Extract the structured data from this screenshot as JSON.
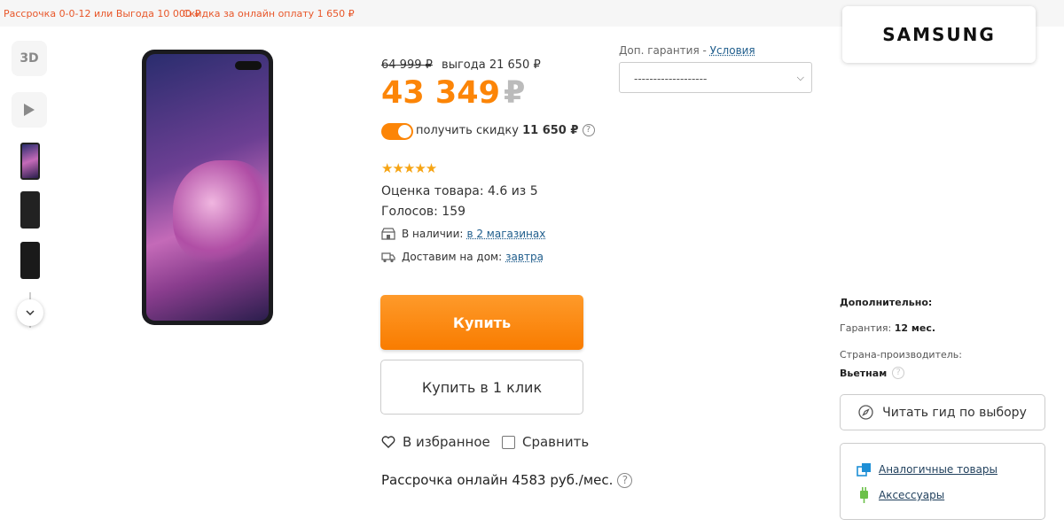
{
  "promo": {
    "installment": "Рассрочка 0-0-12 или Выгода 10 000 ₽",
    "online_discount": "Скидка за онлайн оплату 1 650 ₽"
  },
  "gallery": {
    "btn_3d": "3D",
    "colors": {
      "phone_body": "#1b1b1f"
    }
  },
  "price": {
    "old": "64 999 ₽",
    "benefit": "выгода 21 650 ₽",
    "current": "43 349",
    "currency": "₽",
    "discount_label": "получить скидку",
    "discount_value": "11 650 ₽",
    "accent_color": "#fc8507"
  },
  "rating": {
    "value": 4.6,
    "max": 5,
    "stars": "★★★★★",
    "score_text": "Оценка товара: 4.6 из 5",
    "votes_text": "Голосов: 159"
  },
  "availability": {
    "in_stock_label": "В наличии:",
    "in_stock_link": "в 2 магазинах",
    "delivery_label": "Доставим на дом:",
    "delivery_link": "завтра"
  },
  "actions": {
    "buy": "Купить",
    "buy_one_click": "Купить в 1 клик",
    "favorites": "В избранное",
    "compare": "Сравнить",
    "credit": "Рассрочка онлайн 4583 руб./мес."
  },
  "warranty": {
    "label": "Доп. гарантия - ",
    "link": "Условия",
    "select_value": "-------------------"
  },
  "brand": {
    "name": "SAMSUNG"
  },
  "details": {
    "title": "Дополнительно:",
    "warranty_label": "Гарантия:",
    "warranty_value": "12 мес.",
    "country_label": "Страна-производитель:",
    "country_value": "Вьетнам"
  },
  "guide_button": "Читать гид по выбору",
  "related": {
    "similar": "Аналогичные товары",
    "accessories": "Аксессуары"
  }
}
